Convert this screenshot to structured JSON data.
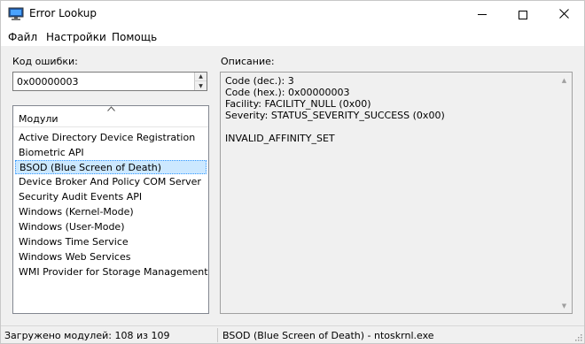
{
  "window": {
    "title": "Error Lookup"
  },
  "menu": [
    "Файл",
    "Настройки",
    "Помощь"
  ],
  "error_code": {
    "label": "Код ошибки:",
    "value": "0x00000003"
  },
  "modules": {
    "header": "Модули",
    "items": [
      "Active Directory Device Registration",
      "Biometric API",
      "BSOD (Blue Screen of Death)",
      "Device Broker And Policy COM Server",
      "Security Audit Events API",
      "Windows (Kernel-Mode)",
      "Windows (User-Mode)",
      "Windows Time Service",
      "Windows Web Services",
      "WMI Provider for Storage Management"
    ],
    "selected": "BSOD (Blue Screen of Death)"
  },
  "description": {
    "label": "Описание:",
    "lines": [
      "Code (dec.): 3",
      "Code (hex.): 0x00000003",
      "Facility: FACILITY_NULL (0x00)",
      "Severity: STATUS_SEVERITY_SUCCESS (0x00)",
      "",
      "INVALID_AFFINITY_SET"
    ]
  },
  "status": {
    "left": "Загружено модулей: 108 из 109",
    "right": "BSOD (Blue Screen of Death) - ntoskrnl.exe"
  },
  "colors": {
    "selection": "#cce8ff",
    "selection_border": "#3399ff"
  },
  "icons": [
    "app-monitor-icon",
    "minimize-icon",
    "maximize-icon",
    "close-icon",
    "spin-up-icon",
    "spin-down-icon",
    "sort-up-icon",
    "scroll-up-icon",
    "scroll-down-icon",
    "size-grip-icon"
  ]
}
